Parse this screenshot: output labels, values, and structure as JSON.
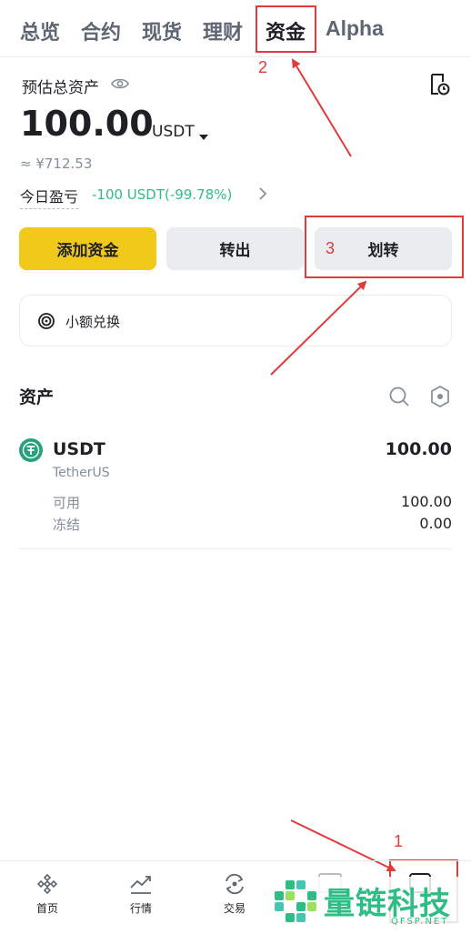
{
  "tabs": [
    {
      "label": "总览"
    },
    {
      "label": "合约"
    },
    {
      "label": "现货"
    },
    {
      "label": "理财"
    },
    {
      "label": "资金"
    },
    {
      "label": "Alpha"
    }
  ],
  "active_tab": "资金",
  "annotations": {
    "one": "1",
    "two": "2",
    "three": "3"
  },
  "balance": {
    "title": "预估总资产",
    "amount": "100.00",
    "currency": "USDT",
    "fiat": "≈ ¥712.53",
    "pnl_label": "今日盈亏",
    "pnl_value": "-100 USDT(-99.78%)"
  },
  "actions": {
    "add": "添加资金",
    "withdraw": "转出",
    "transfer": "划转"
  },
  "small_convert": "小额兑换",
  "assets": {
    "title": "资产",
    "items": [
      {
        "symbol": "USDT",
        "name": "TetherUS",
        "total": "100.00",
        "available_label": "可用",
        "available": "100.00",
        "frozen_label": "冻结",
        "frozen": "0.00"
      }
    ]
  },
  "bottom_nav": [
    {
      "label": "首页"
    },
    {
      "label": "行情"
    },
    {
      "label": "交易"
    }
  ],
  "watermark": {
    "text": "量链科技",
    "sub": "QFSP.NET"
  },
  "colors": {
    "accent": "#f0c91a",
    "positive": "#2ebd85",
    "annotation": "#e23a3a",
    "text": "#1e2026",
    "muted": "#848e9c"
  }
}
